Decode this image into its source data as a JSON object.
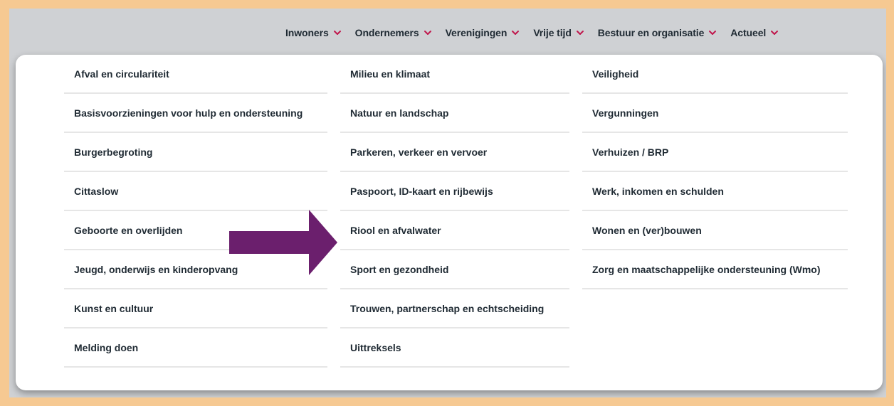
{
  "colors": {
    "page_border": "#f6c992",
    "header_bg": "#cfd1d4",
    "chevron": "#c0174c",
    "arrow": "#6b1f6d",
    "text": "#1f2a33"
  },
  "topnav": [
    {
      "label": "Inwoners",
      "icon": "chevron-down-icon"
    },
    {
      "label": "Ondernemers",
      "icon": "chevron-down-icon"
    },
    {
      "label": "Verenigingen",
      "icon": "chevron-down-icon"
    },
    {
      "label": "Vrije tijd",
      "icon": "chevron-down-icon"
    },
    {
      "label": "Bestuur en organisatie",
      "icon": "chevron-down-icon"
    },
    {
      "label": "Actueel",
      "icon": "chevron-down-icon"
    }
  ],
  "dropdown": {
    "columns": [
      [
        "Afval en circulariteit",
        "Basisvoorzieningen voor hulp en ondersteuning",
        "Burgerbegroting",
        "Cittaslow",
        "Geboorte en overlijden",
        "Jeugd, onderwijs en kinderopvang",
        "Kunst en cultuur",
        "Melding doen"
      ],
      [
        "Milieu en klimaat",
        "Natuur en landschap",
        "Parkeren, verkeer en vervoer",
        "Paspoort, ID-kaart en rijbewijs",
        "Riool en afvalwater",
        "Sport en gezondheid",
        "Trouwen, partnerschap en echtscheiding",
        "Uittreksels"
      ],
      [
        "Veiligheid",
        "Vergunningen",
        "Verhuizen / BRP",
        "Werk, inkomen en schulden",
        "Wonen en (ver)bouwen",
        "Zorg en maatschappelijke ondersteuning (Wmo)"
      ]
    ]
  },
  "annotation": {
    "icon": "arrow-right-icon"
  }
}
